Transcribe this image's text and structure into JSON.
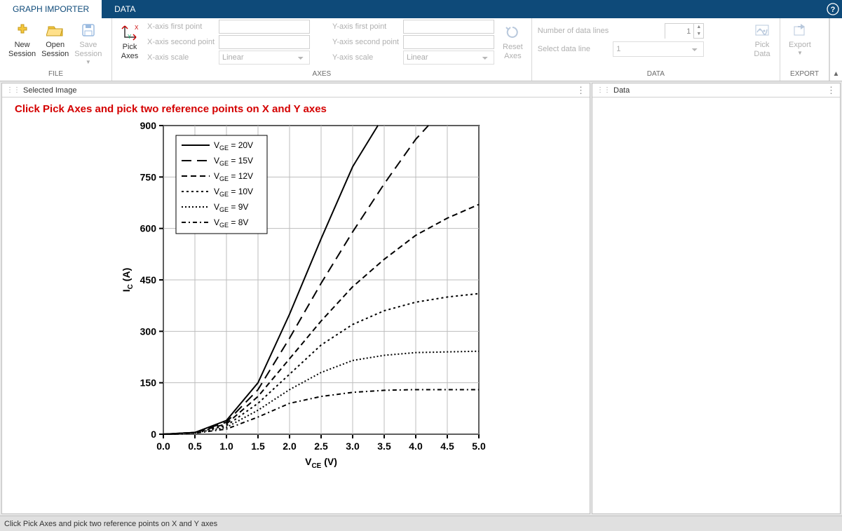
{
  "tabs": {
    "graph_importer": "GRAPH IMPORTER",
    "data": "DATA"
  },
  "ribbon": {
    "file": {
      "title": "FILE",
      "new_session": "New\nSession",
      "open_session": "Open\nSession",
      "save_session": "Save\nSession"
    },
    "axes": {
      "title": "AXES",
      "pick_axes": "Pick\nAxes",
      "x_first": "X-axis first point",
      "x_second": "X-axis second point",
      "x_scale": "X-axis scale",
      "y_first": "Y-axis first point",
      "y_second": "Y-axis second point",
      "y_scale": "Y-axis scale",
      "scale_value": "Linear",
      "reset_axes": "Reset\nAxes"
    },
    "data_group": {
      "title": "DATA",
      "num_lines": "Number of data lines",
      "num_lines_value": "1",
      "select_line": "Select data line",
      "select_line_value": "1",
      "pick_data": "Pick\nData"
    },
    "export": {
      "title": "EXPORT",
      "export": "Export"
    }
  },
  "panels": {
    "selected_image": "Selected Image",
    "data": "Data"
  },
  "instruction": "Click Pick Axes and pick two reference points on X and Y axes",
  "status": "Click Pick Axes and pick two reference points on X and Y axes",
  "chart_data": {
    "type": "line",
    "title": "",
    "xlabel": "V_CE (V)",
    "ylabel": "I_C (A)",
    "xlim": [
      0,
      5.0
    ],
    "ylim": [
      0,
      900
    ],
    "xticks": [
      0.0,
      0.5,
      1.0,
      1.5,
      2.0,
      2.5,
      3.0,
      3.5,
      4.0,
      4.5,
      5.0
    ],
    "yticks": [
      0,
      150,
      300,
      450,
      600,
      750,
      900
    ],
    "series": [
      {
        "name": "V_GE = 20V",
        "dash": "",
        "x": [
          0.0,
          0.5,
          1.0,
          1.5,
          2.0,
          2.5,
          3.0,
          3.4
        ],
        "y": [
          0,
          5,
          40,
          150,
          350,
          570,
          780,
          900
        ]
      },
      {
        "name": "V_GE = 15V",
        "dash": "14,8",
        "x": [
          0.0,
          0.5,
          1.0,
          1.5,
          2.0,
          2.5,
          3.0,
          3.5,
          4.0,
          4.2
        ],
        "y": [
          0,
          5,
          35,
          130,
          280,
          440,
          590,
          730,
          860,
          900
        ]
      },
      {
        "name": "V_GE = 12V",
        "dash": "8,5",
        "x": [
          0.0,
          0.5,
          1.0,
          1.5,
          2.0,
          2.5,
          3.0,
          3.5,
          4.0,
          4.5,
          5.0
        ],
        "y": [
          0,
          5,
          30,
          110,
          220,
          330,
          430,
          510,
          580,
          630,
          670
        ]
      },
      {
        "name": "V_GE = 10V",
        "dash": "3,4",
        "x": [
          0.0,
          0.5,
          1.0,
          1.5,
          2.0,
          2.5,
          3.0,
          3.5,
          4.0,
          4.5,
          5.0
        ],
        "y": [
          0,
          5,
          25,
          90,
          175,
          260,
          320,
          360,
          385,
          400,
          410
        ]
      },
      {
        "name": "V_GE = 9V",
        "dash": "2,3",
        "x": [
          0.0,
          0.5,
          1.0,
          1.5,
          2.0,
          2.5,
          3.0,
          3.5,
          4.0,
          4.5,
          5.0
        ],
        "y": [
          0,
          4,
          20,
          70,
          130,
          180,
          215,
          230,
          238,
          240,
          242
        ]
      },
      {
        "name": "V_GE = 8V",
        "dash": "6,4,2,4",
        "x": [
          0.0,
          0.5,
          1.0,
          1.5,
          2.0,
          2.5,
          3.0,
          3.5,
          4.0,
          4.5,
          5.0
        ],
        "y": [
          0,
          3,
          15,
          50,
          90,
          110,
          122,
          128,
          130,
          130,
          130
        ]
      }
    ]
  }
}
